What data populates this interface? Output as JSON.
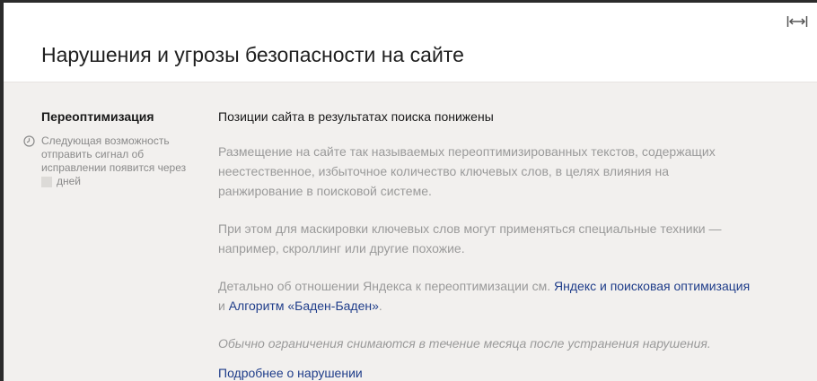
{
  "dialog": {
    "title": "Нарушения и угрозы безопасности на сайте",
    "expand_icon": "expand-horizontal-icon"
  },
  "sidebar": {
    "title": "Переоптимизация",
    "note_icon": "clock-icon",
    "note_line1": "Следующая возможность",
    "note_line2": "отправить сигнал об",
    "note_line3": "исправлении появится через",
    "note_days": "дней"
  },
  "main": {
    "heading": "Позиции сайта в результатах поиска понижены",
    "para1_line1": "Размещение на сайте так называемых переоптимизированных текстов, содержащих",
    "para1_line2": "неестественное, избыточное количество ключевых слов, в целях влияния на",
    "para1_line3": "ранжирование в поисковой системе.",
    "para2_line1": "При этом для маскировки ключевых слов могут применяться специальные техники —",
    "para2_line2": "например, скроллинг или другие похожие.",
    "para3_text1": "Детально об отношении Яндекса к переоптимизации см.",
    "para3_link1": "Яндекс и поисковая оптимизация",
    "para3_and": "и",
    "para3_link2": "Алгоритм «Баден-Баден»",
    "para3_dot": ".",
    "para4": "Обычно ограничения снимаются в течение месяца после устранения нарушения.",
    "more_link": "Подробнее о нарушении"
  },
  "colors": {
    "panel_bg": "#f2f0ee",
    "link": "#1f3d8a",
    "muted_text": "#9a9a9a"
  }
}
